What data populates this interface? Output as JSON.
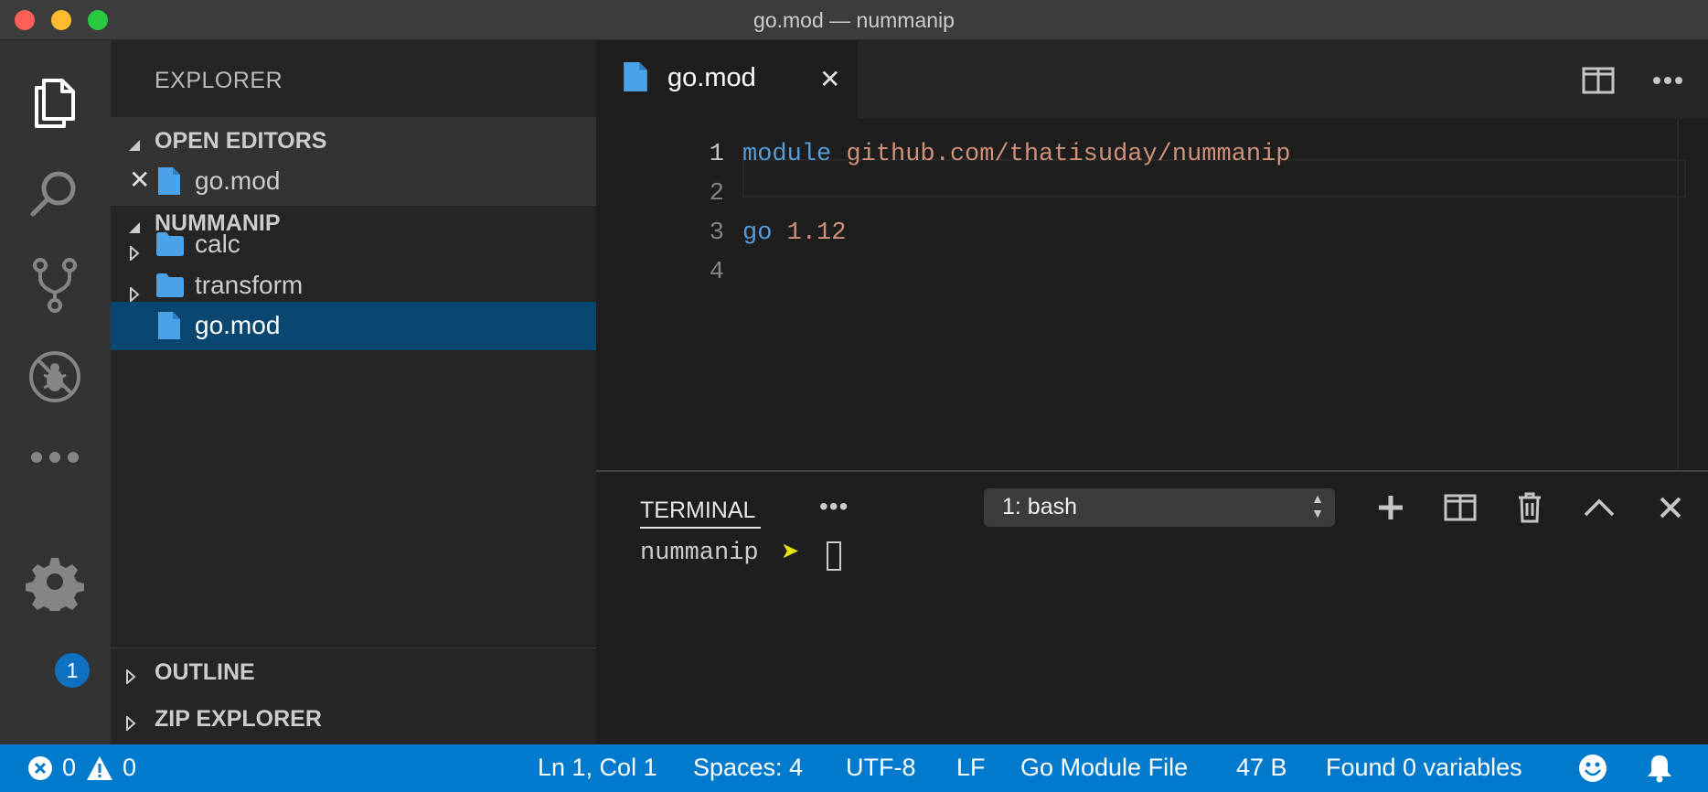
{
  "window": {
    "title": "go.mod — nummanip"
  },
  "activity_bar": {
    "items": [
      "files-icon",
      "search-icon",
      "source-control-icon",
      "no-debug-icon",
      "more-icon"
    ],
    "settings_badge": "1"
  },
  "sidebar": {
    "title": "EXPLORER",
    "open_editors": {
      "header": "OPEN EDITORS",
      "items": [
        {
          "label": "go.mod"
        }
      ]
    },
    "folder": {
      "header": "NUMMANIP",
      "items": [
        {
          "label": "calc",
          "type": "folder"
        },
        {
          "label": "transform",
          "type": "folder"
        },
        {
          "label": "go.mod",
          "type": "file",
          "selected": true
        }
      ]
    },
    "outline": {
      "header": "OUTLINE"
    },
    "zip_explorer": {
      "header": "ZIP EXPLORER"
    }
  },
  "editor": {
    "tab": {
      "label": "go.mod"
    },
    "line_numbers": [
      "1",
      "2",
      "3",
      "4"
    ],
    "lines": [
      {
        "keyword": "module",
        "value": "github.com/thatisuday/nummanip"
      },
      {
        "keyword": "",
        "value": ""
      },
      {
        "keyword": "go",
        "value": "1.12"
      },
      {
        "keyword": "",
        "value": ""
      }
    ]
  },
  "panel": {
    "tab": "TERMINAL",
    "more": "•••",
    "terminal_select": "1: bash",
    "prompt": "nummanip",
    "prompt_symbol": "➤"
  },
  "status_bar": {
    "errors": "0",
    "warnings": "0",
    "position": "Ln 1, Col 1",
    "spaces": "Spaces: 4",
    "encoding": "UTF-8",
    "eol": "LF",
    "language": "Go Module File",
    "size": "47 B",
    "variables": "Found 0 variables"
  },
  "colors": {
    "accent": "#007acc",
    "selection": "#094771",
    "keyword": "#569cd6",
    "string": "#ce9178",
    "file_icon": "#519aba",
    "folder_icon": "#4aa3e8"
  }
}
